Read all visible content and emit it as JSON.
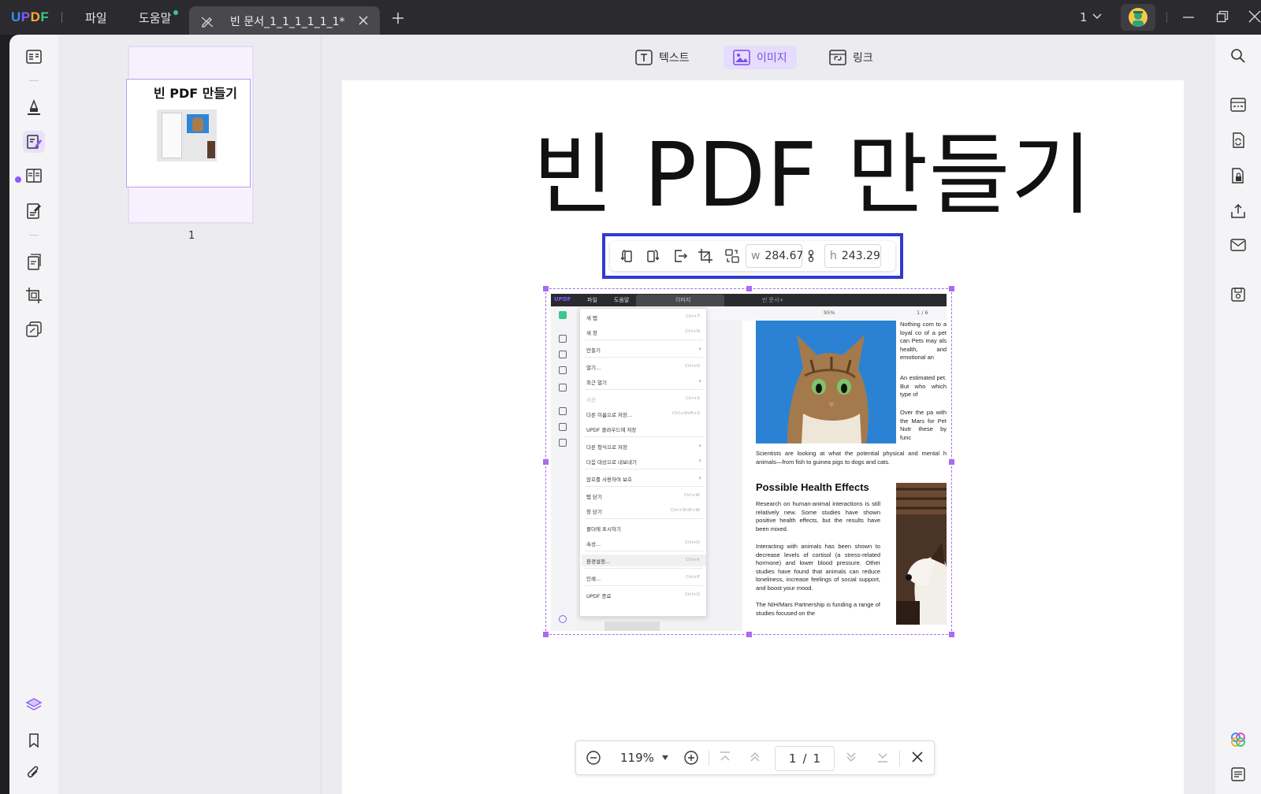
{
  "titlebar": {
    "logo": {
      "u": "U",
      "p": "P",
      "d": "D",
      "f": "F"
    },
    "menus": [
      "파일",
      "도움말"
    ],
    "tab_title": "빈 문서_1_1_1_1_1_1*",
    "window_count": "1"
  },
  "colors": {
    "accent": "#8b5cf6",
    "selection_toolbar_border": "#2f3bd0",
    "titlebar": "#2b2b2f"
  },
  "edit_toolbar": {
    "tools": [
      {
        "label": "텍스트",
        "icon": "text-box-icon"
      },
      {
        "label": "이미지",
        "icon": "image-icon",
        "active": true
      },
      {
        "label": "링크",
        "icon": "link-icon"
      }
    ]
  },
  "thumbnails": {
    "page_title": "빈 PDF 만들기",
    "page_number": "1"
  },
  "page": {
    "title": "빈 PDF 만들기"
  },
  "image_toolbar": {
    "width_label": "w",
    "width_value": "284.67",
    "height_label": "h",
    "height_value": "243.29"
  },
  "embedded_screenshot": {
    "logo": "UPDF",
    "menus": [
      "파일",
      "도움말"
    ],
    "tabs": [
      "이미지",
      "빈 문서+"
    ],
    "zoom": "95%",
    "page": "1 / 6",
    "menu_items": [
      {
        "label": "새 탭",
        "shortcut": "Ctrl+T"
      },
      {
        "label": "새 창",
        "shortcut": "Ctrl+N"
      },
      {
        "label": "만들기",
        "arrow": true
      },
      {
        "label": "열기...",
        "shortcut": "Ctrl+O"
      },
      {
        "label": "최근 열기",
        "arrow": true
      },
      {
        "label": "저장",
        "shortcut": "Ctrl+S",
        "dim": true
      },
      {
        "label": "다른 이름으로 저장...",
        "shortcut": "Ctrl+Shift+S"
      },
      {
        "label": "UPDF 클라우드에 저장"
      },
      {
        "label": "다른 형식으로 저장",
        "arrow": true
      },
      {
        "label": "다음 대상으로 내보내기",
        "arrow": true
      },
      {
        "label": "암호를 사용하여 보호",
        "arrow": true
      },
      {
        "label": "탭 닫기",
        "shortcut": "Ctrl+W"
      },
      {
        "label": "창 닫기",
        "shortcut": "Ctrl+Shift+W"
      },
      {
        "label": "폴더에 표시하기"
      },
      {
        "label": "속성...",
        "shortcut": "Ctrl+D"
      },
      {
        "label": "환경설정...",
        "shortcut": "Ctrl+K",
        "highlight": true
      },
      {
        "label": "인쇄...",
        "shortcut": "Ctrl+P"
      },
      {
        "label": "UPDF 종료",
        "shortcut": "Ctrl+Q"
      }
    ],
    "side_text": "Nothing com to a loyal co of a pet can Pets may als health, and emotional an",
    "side_text2": "An estimated pet. But who which type of",
    "side_text3": "Over the pa with the Mars for Pet Nutr these by func",
    "caption": "Scientists are looking at what the potential physical and mental h animals—from fish to guinea pigs to dogs and cats.",
    "heading": "Possible Health Effects",
    "para1": "Research on human-animal interactions is still relatively new. Some studies have shown positive health effects, but the results have been mixed.",
    "para2": "Interacting with animals has been shown to decrease levels of cortisol (a stress-related hormone) and lower blood pressure. Other studies have found that animals can reduce loneliness, increase feelings of social support, and boost your mood.",
    "para3": "The NIH/Mars Partnership is funding a range of studies focused on the"
  },
  "zoombar": {
    "zoom": "119%",
    "current_page": "1",
    "separator": "/",
    "total_pages": "1"
  }
}
